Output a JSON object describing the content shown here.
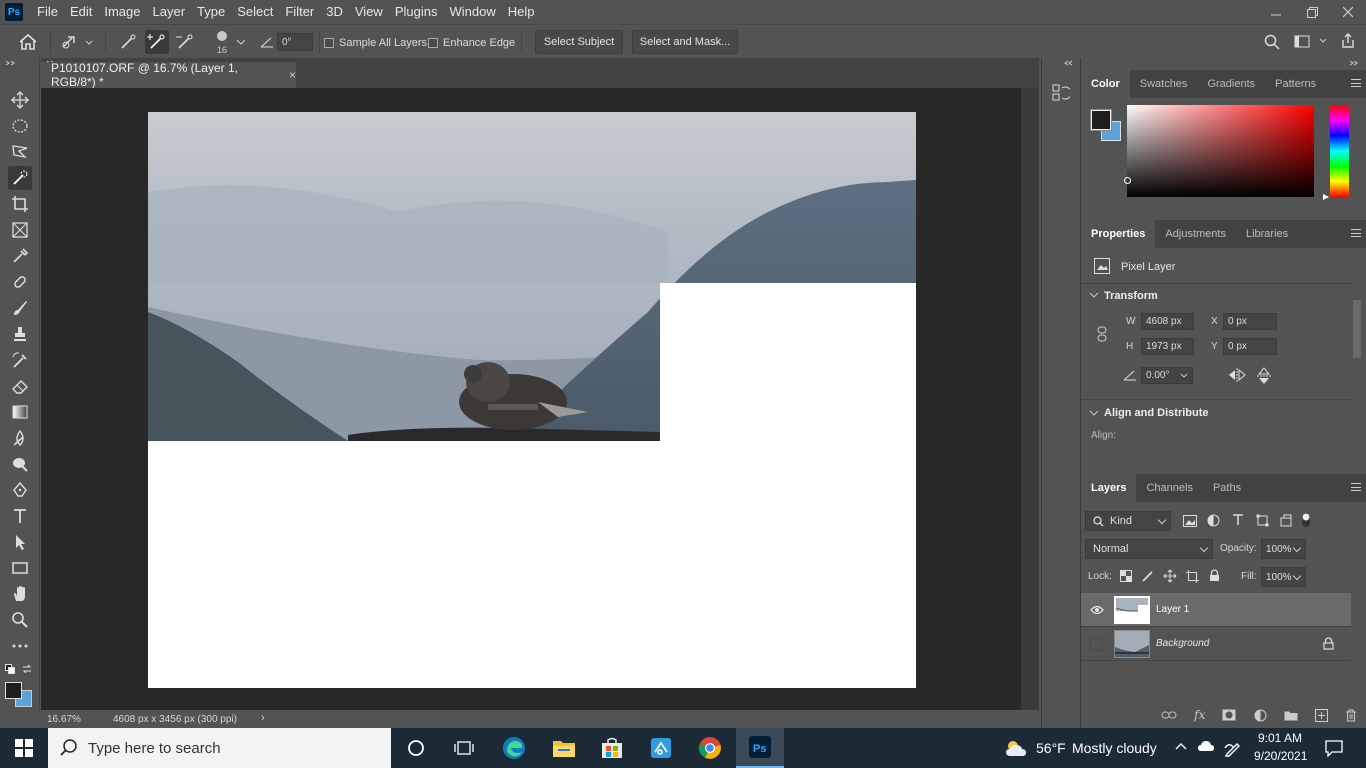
{
  "app": {
    "logo": "Ps"
  },
  "menu": [
    "File",
    "Edit",
    "Image",
    "Layer",
    "Type",
    "Select",
    "Filter",
    "3D",
    "View",
    "Plugins",
    "Window",
    "Help"
  ],
  "options_bar": {
    "brush_size": "16",
    "angle_value": "0°",
    "sample_all_layers": "Sample All Layers",
    "enhance_edge": "Enhance Edge",
    "select_subject": "Select Subject",
    "select_and_mask": "Select and Mask..."
  },
  "document": {
    "tab_title": "P1010107.ORF @ 16.7% (Layer 1, RGB/8*) *",
    "zoom": "16.67%",
    "doc_info": "4608 px x 3456 px (300 ppi)"
  },
  "color_panel": {
    "tabs": [
      "Color",
      "Swatches",
      "Gradients",
      "Patterns"
    ],
    "foreground": "#1e1e1e",
    "background": "#5ea2dc"
  },
  "properties_panel": {
    "tabs": [
      "Properties",
      "Adjustments",
      "Libraries"
    ],
    "kind": "Pixel Layer",
    "transform_header": "Transform",
    "w_label": "W",
    "w_value": "4608 px",
    "h_label": "H",
    "h_value": "1973 px",
    "x_label": "X",
    "x_value": "0 px",
    "y_label": "Y",
    "y_value": "0 px",
    "angle_value": "0.00°",
    "align_header": "Align and Distribute",
    "align_label": "Align:"
  },
  "layers_panel": {
    "tabs": [
      "Layers",
      "Channels",
      "Paths"
    ],
    "filter_kind": "Kind",
    "blend_mode": "Normal",
    "opacity_label": "Opacity:",
    "opacity_value": "100%",
    "lock_label": "Lock:",
    "fill_label": "Fill:",
    "fill_value": "100%",
    "layers": [
      {
        "name": "Layer 1",
        "visible": true,
        "selected": true
      },
      {
        "name": "Background",
        "visible": false,
        "locked": true
      }
    ]
  },
  "taskbar": {
    "search_placeholder": "Type here to search",
    "weather_temp": "56°F",
    "weather_text": "Mostly cloudy",
    "time": "9:01 AM",
    "date": "9/20/2021"
  }
}
